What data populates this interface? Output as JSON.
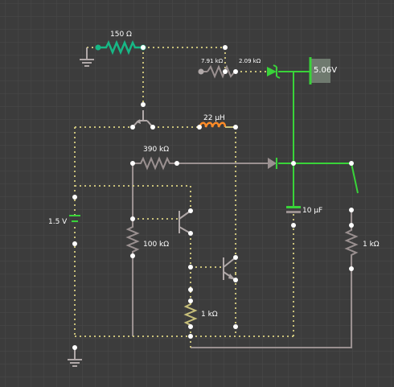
{
  "colors": {
    "background": "#3c3c3c",
    "grid": "#4a4a4a",
    "wire_idle": "#9a9090",
    "wire_active": "#39d339",
    "current_dot": "#f2d641",
    "component_idle": "#8a8a8a",
    "probe": "#17b886",
    "inductor": "#ff8c28",
    "meter_bg": "#6f7a6f"
  },
  "components": {
    "r_150": {
      "label": "150 Ω"
    },
    "r_7k91": {
      "label": "7.91 kΩ"
    },
    "r_2k09": {
      "label": "2.09 kΩ"
    },
    "inductor": {
      "label": "22 μH"
    },
    "r_390k": {
      "label": "390 kΩ"
    },
    "battery": {
      "label": "1.5 V"
    },
    "capacitor": {
      "label": "10 μF"
    },
    "r_100k": {
      "label": "100 kΩ"
    },
    "r_1k_emitter": {
      "label": "1 kΩ"
    },
    "r_1k_right": {
      "label": "1 kΩ"
    },
    "voltmeter": {
      "label": "5.06V"
    }
  }
}
